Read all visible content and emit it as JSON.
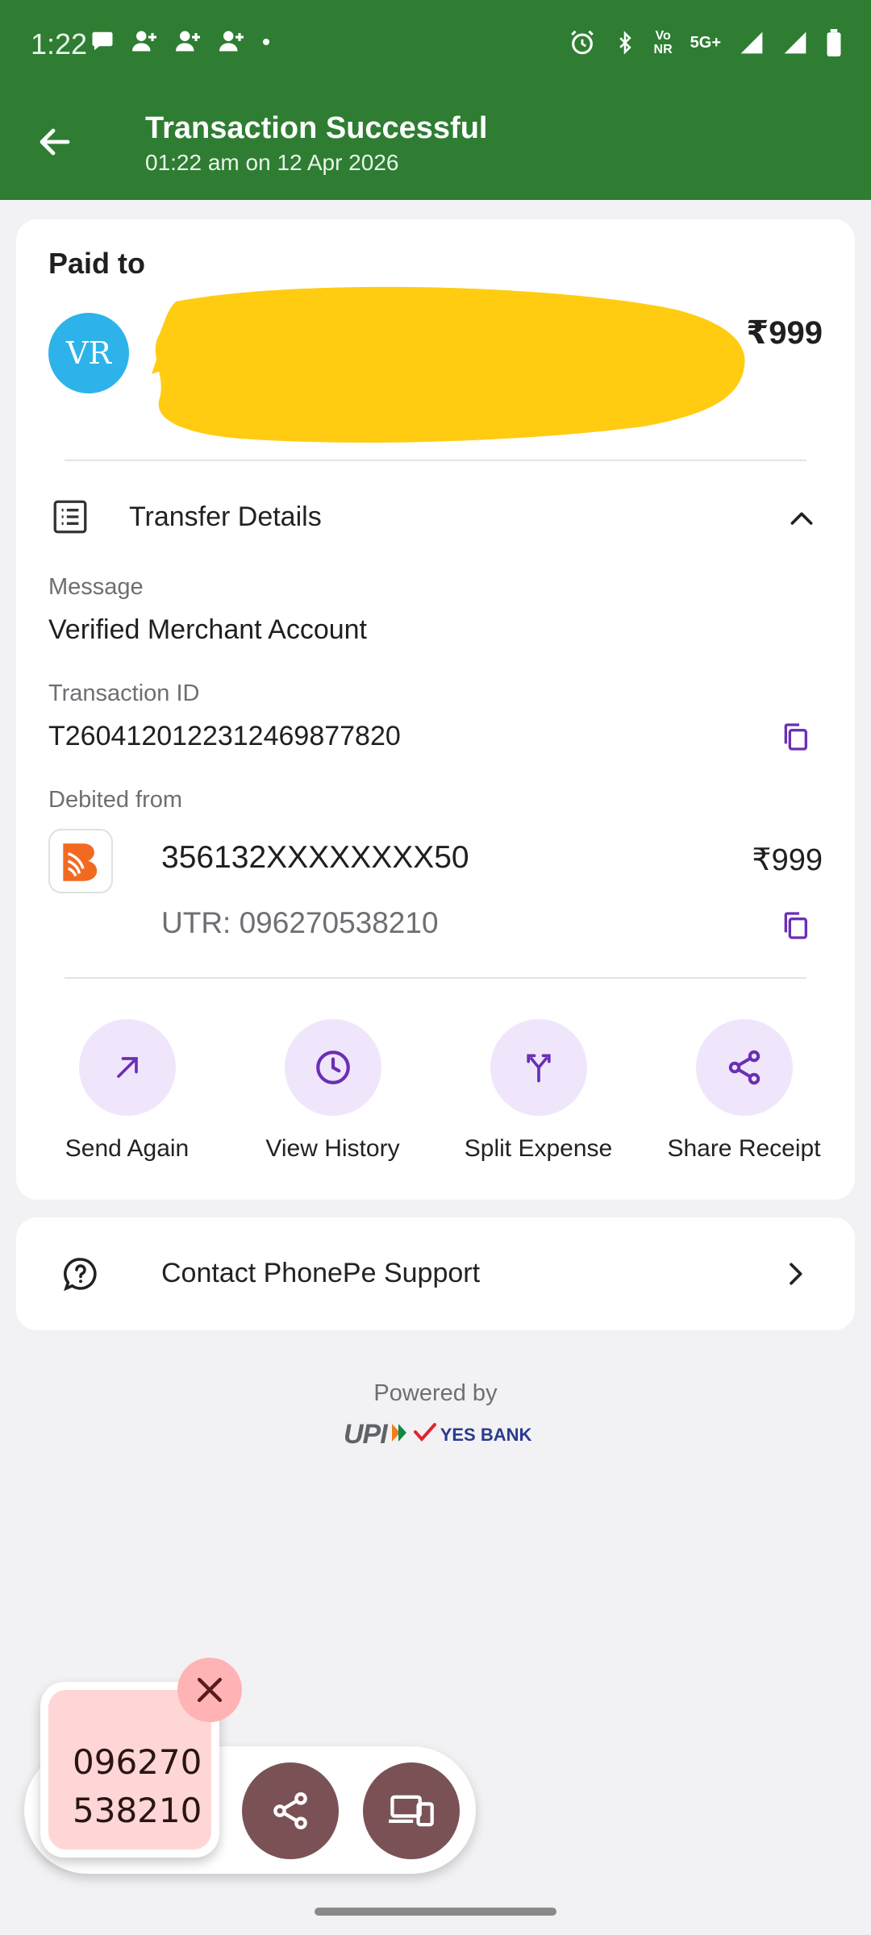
{
  "status_bar": {
    "time": "1:22",
    "volte_line1": "Vo",
    "volte_line2": "NR",
    "network": "5G+"
  },
  "header": {
    "title": "Transaction Successful",
    "subtitle": "01:22 am on 12 Apr 2026"
  },
  "payment": {
    "paid_to_label": "Paid to",
    "avatar_initials": "VR",
    "amount": "₹999"
  },
  "transfer_details": {
    "title": "Transfer Details",
    "message_label": "Message",
    "message_value": "Verified Merchant Account",
    "transaction_id_label": "Transaction ID",
    "transaction_id_value": "T2604120122312469877820",
    "debited_from_label": "Debited from",
    "account_number": "356132XXXXXXXX50",
    "debit_amount": "₹999",
    "utr": "UTR: 096270538210"
  },
  "actions": [
    {
      "label": "Send Again",
      "icon": "arrow-up-right-icon"
    },
    {
      "label": "View History",
      "icon": "clock-icon"
    },
    {
      "label": "Split Expense",
      "icon": "split-icon"
    },
    {
      "label": "Share Receipt",
      "icon": "share-icon"
    }
  ],
  "support": {
    "label": "Contact PhonePe Support"
  },
  "footer": {
    "powered_by": "Powered by",
    "upi_text": "UPI",
    "bank_text": "YES BANK"
  },
  "otp_overlay": {
    "line1": "096270",
    "line2": "538210"
  },
  "colors": {
    "header_green": "#2e7d32",
    "accent_purple": "#6a2fb5",
    "avatar_blue": "#2db3ea",
    "fab_brown": "#7a5256"
  }
}
